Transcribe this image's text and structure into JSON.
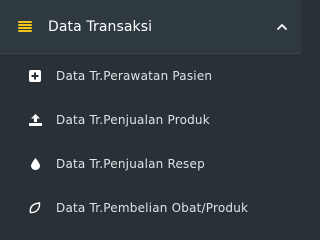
{
  "section": {
    "title": "Data Transaksi",
    "icon": "list-icon",
    "expanded_icon": "chevron-up-icon",
    "accent": "#f0c419"
  },
  "items": [
    {
      "label": "Data Tr.Perawatan Pasien",
      "icon": "plus-square-icon"
    },
    {
      "label": "Data Tr.Penjualan Produk",
      "icon": "upload-icon"
    },
    {
      "label": "Data Tr.Penjualan Resep",
      "icon": "tint-icon"
    },
    {
      "label": "Data Tr.Pembelian Obat/Produk",
      "icon": "leaf-icon"
    }
  ]
}
